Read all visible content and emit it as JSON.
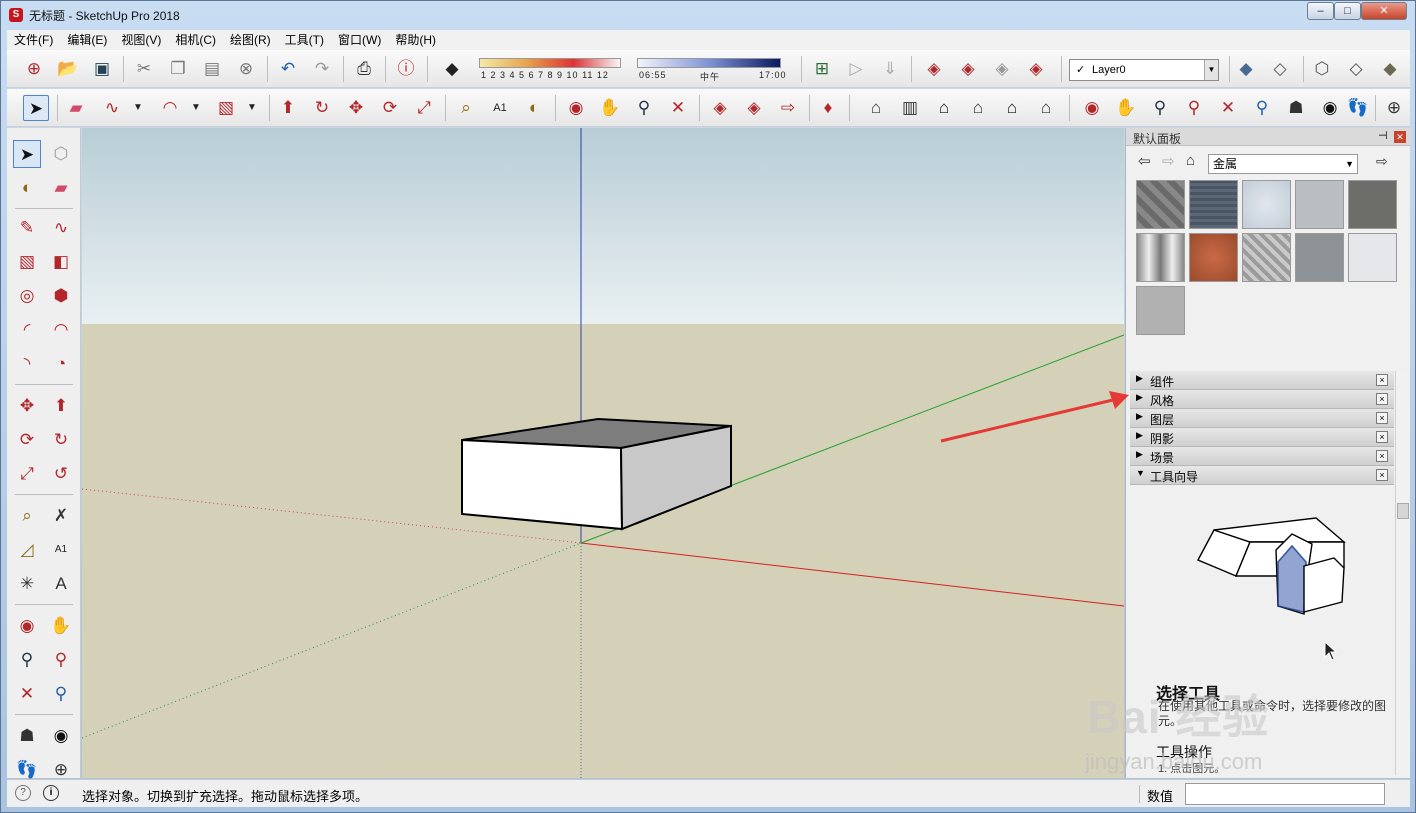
{
  "window": {
    "title": "无标题 - SketchUp Pro 2018",
    "minimize": "–",
    "maximize": "□",
    "close": "✕"
  },
  "menu": [
    "文件(F)",
    "编辑(E)",
    "视图(V)",
    "相机(C)",
    "绘图(R)",
    "工具(T)",
    "窗口(W)",
    "帮助(H)"
  ],
  "toolbar": {
    "shadow_months": "1 2 3 4 5 6 7 8 9 10 11 12",
    "time_start": "06:55",
    "time_mid": "中午",
    "time_end": "17:00",
    "layer_value": "Layer0",
    "layer_check": "✓"
  },
  "tray": {
    "title": "默认面板",
    "pin": "⊣",
    "close": "✕",
    "material_category": "金属",
    "sections": [
      {
        "label": "组件",
        "arrow": "▶",
        "close": "×"
      },
      {
        "label": "风格",
        "arrow": "▶",
        "close": "×"
      },
      {
        "label": "图层",
        "arrow": "▶",
        "close": "×"
      },
      {
        "label": "阴影",
        "arrow": "▶",
        "close": "×"
      },
      {
        "label": "场景",
        "arrow": "▶",
        "close": "×"
      },
      {
        "label": "工具向导",
        "arrow": "▼",
        "close": "×"
      }
    ],
    "instructor_title": "选择工具",
    "instructor_body": "在使用其他工具或命令时，选择要修改的图元。",
    "ops_title": "工具操作",
    "ops_body": "1. 点击图元。"
  },
  "status": {
    "text": "选择对象。切换到扩充选择。拖动鼠标选择多项。",
    "measurements_label": "数值",
    "measurements_value": ""
  },
  "watermark": {
    "brand": "Bai  经验",
    "url": "jingyan.baidu.com"
  },
  "colors": {
    "sky_top": "#b8cdd6",
    "sky_bottom": "#e9f0f2",
    "ground": "#d5d0b8",
    "accent_red": "#b3262a",
    "annotation_arrow": "#e53935"
  }
}
